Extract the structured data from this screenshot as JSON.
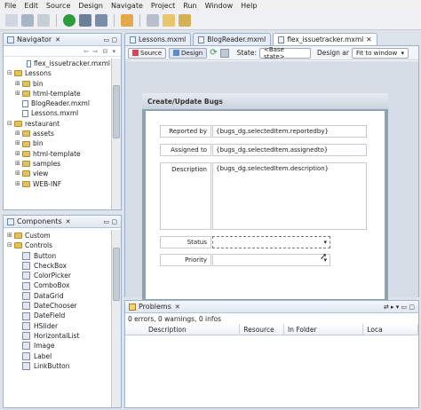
{
  "menu": [
    "File",
    "Edit",
    "Source",
    "Design",
    "Navigate",
    "Project",
    "Run",
    "Window",
    "Help"
  ],
  "navigator": {
    "title": "Navigator",
    "items": [
      {
        "label": "flex_issuetracker.mxml",
        "kind": "file",
        "depth": 2
      },
      {
        "label": "Lessons",
        "kind": "folder",
        "depth": 0,
        "twisty": "⊟"
      },
      {
        "label": "bin",
        "kind": "folder",
        "depth": 1,
        "twisty": "⊞"
      },
      {
        "label": "html-template",
        "kind": "folder",
        "depth": 1,
        "twisty": "⊞"
      },
      {
        "label": "BlogReader.mxml",
        "kind": "file",
        "depth": 1
      },
      {
        "label": "Lessons.mxml",
        "kind": "file",
        "depth": 1
      },
      {
        "label": "restaurant",
        "kind": "folder",
        "depth": 0,
        "twisty": "⊟"
      },
      {
        "label": "assets",
        "kind": "folder",
        "depth": 1,
        "twisty": "⊞"
      },
      {
        "label": "bin",
        "kind": "folder",
        "depth": 1,
        "twisty": "⊞"
      },
      {
        "label": "html-template",
        "kind": "folder",
        "depth": 1,
        "twisty": "⊞"
      },
      {
        "label": "samples",
        "kind": "folder",
        "depth": 1,
        "twisty": "⊞"
      },
      {
        "label": "view",
        "kind": "folder",
        "depth": 1,
        "twisty": "⊞"
      },
      {
        "label": "WEB-INF",
        "kind": "folder",
        "depth": 1,
        "twisty": "⊞"
      }
    ]
  },
  "components": {
    "title": "Components",
    "items": [
      {
        "label": "Custom",
        "kind": "folder",
        "depth": 0,
        "twisty": "⊞"
      },
      {
        "label": "Controls",
        "kind": "folder",
        "depth": 0,
        "twisty": "⊟"
      },
      {
        "label": "Button",
        "kind": "comp",
        "depth": 1
      },
      {
        "label": "CheckBox",
        "kind": "comp",
        "depth": 1
      },
      {
        "label": "ColorPicker",
        "kind": "comp",
        "depth": 1
      },
      {
        "label": "ComboBox",
        "kind": "comp",
        "depth": 1
      },
      {
        "label": "DataGrid",
        "kind": "comp",
        "depth": 1
      },
      {
        "label": "DateChooser",
        "kind": "comp",
        "depth": 1
      },
      {
        "label": "DateField",
        "kind": "comp",
        "depth": 1
      },
      {
        "label": "HSlider",
        "kind": "comp",
        "depth": 1
      },
      {
        "label": "HorizontalList",
        "kind": "comp",
        "depth": 1
      },
      {
        "label": "Image",
        "kind": "comp",
        "depth": 1
      },
      {
        "label": "Label",
        "kind": "comp",
        "depth": 1
      },
      {
        "label": "LinkButton",
        "kind": "comp",
        "depth": 1
      }
    ]
  },
  "editor": {
    "tabs": [
      {
        "label": "Lessons.mxml",
        "active": false
      },
      {
        "label": "BlogReader.mxml",
        "active": false
      },
      {
        "label": "flex_issuetracker.mxml",
        "active": true
      }
    ],
    "source_label": "Source",
    "design_label": "Design",
    "state_label": "State:",
    "state_value": "<Base state>",
    "design_area_label": "Design ar",
    "fit_value": "Fit to window",
    "form": {
      "title": "Create/Update Bugs",
      "reported_by_label": "Reported by",
      "reported_by_value": "{bugs_dg.selectedItem.reportedby}",
      "assigned_to_label": "Assigned to",
      "assigned_to_value": "{bugs_dg.selectedItem.assignedto}",
      "description_label": "Description",
      "description_value": "{bugs_dg.selectedItem.description}",
      "status_label": "Status",
      "priority_label": "Priority"
    }
  },
  "problems": {
    "title": "Problems",
    "summary": "0 errors, 0 warnings, 0 infos",
    "columns": [
      "Description",
      "Resource",
      "In Folder",
      "Loca"
    ]
  }
}
